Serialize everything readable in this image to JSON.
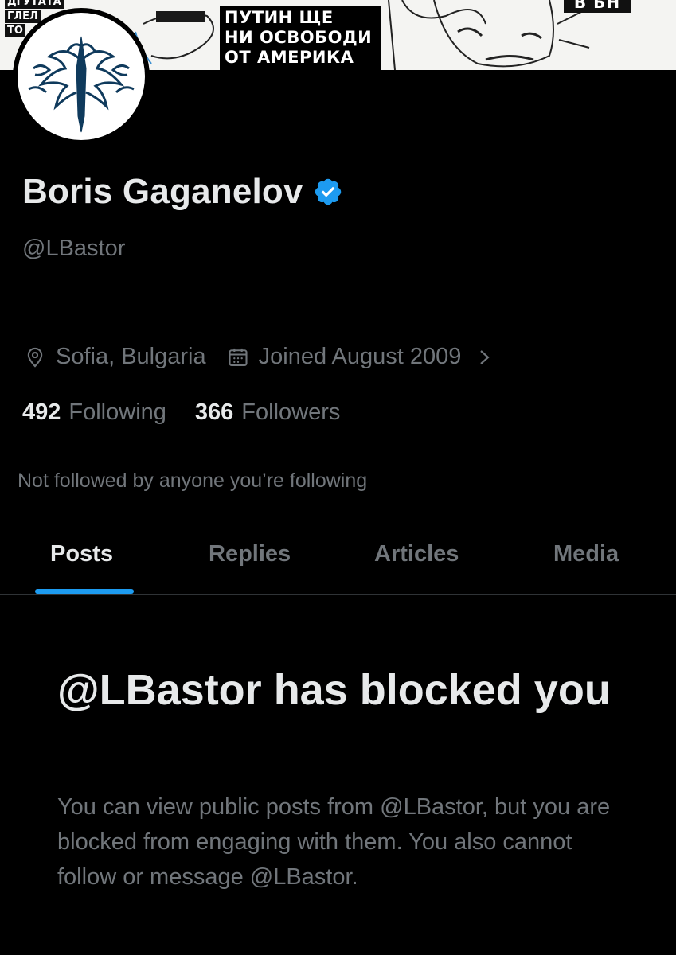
{
  "banner": {
    "left_lines": [
      "ДГУТАТА",
      "ГЛЕЛ",
      "ТО"
    ],
    "meme_lines": [
      "ПУТИН ЩЕ",
      "НИ ОСВОБОДИ",
      "ОТ АМЕРИКА"
    ],
    "right_tag": "В БН"
  },
  "profile": {
    "display_name": "Boris Gaganelov",
    "handle": "@LBastor",
    "location": "Sofia, Bulgaria",
    "joined": "Joined August 2009",
    "following_count": "492",
    "following_label": "Following",
    "followers_count": "366",
    "followers_label": "Followers",
    "followed_by": "Not followed by anyone you’re following",
    "verified_color": "#1d9bf0"
  },
  "tabs": [
    {
      "label": "Posts",
      "active": true
    },
    {
      "label": "Replies",
      "active": false
    },
    {
      "label": "Articles",
      "active": false
    },
    {
      "label": "Media",
      "active": false
    }
  ],
  "blocked": {
    "title": "@LBastor has blocked you",
    "body": "You can view public posts from @LBastor, but you are blocked from engaging with them. You also cannot follow or message @LBastor."
  },
  "icons": {
    "location": "location-pin-icon",
    "calendar": "calendar-icon",
    "chevron": "chevron-right-icon",
    "verified": "verified-badge-icon"
  }
}
